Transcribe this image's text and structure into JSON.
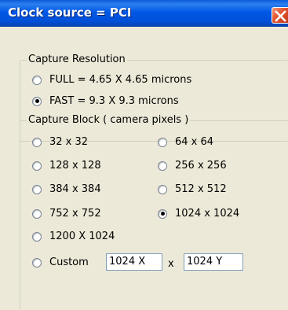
{
  "window": {
    "title": "Clock source = PCI",
    "close_icon": "close-x-icon"
  },
  "capture_resolution": {
    "legend": "Capture Resolution",
    "options": [
      {
        "label": "FULL = 4.65 X 4.65 microns",
        "selected": false
      },
      {
        "label": "FAST = 9.3 X 9.3 microns",
        "selected": true
      }
    ]
  },
  "capture_block": {
    "legend": "Capture Block ( camera pixels )",
    "options": [
      {
        "label": "32 x 32",
        "selected": false
      },
      {
        "label": "64 x 64",
        "selected": false
      },
      {
        "label": "128 x 128",
        "selected": false
      },
      {
        "label": "256 x 256",
        "selected": false
      },
      {
        "label": "384 x 384",
        "selected": false
      },
      {
        "label": "512 x 512",
        "selected": false
      },
      {
        "label": "752 x 752",
        "selected": false
      },
      {
        "label": "1024 x 1024",
        "selected": true
      },
      {
        "label": "1200 X 1024",
        "selected": false
      },
      {
        "label": "Custom",
        "selected": false
      }
    ],
    "custom_x_value": "1024 X",
    "custom_separator": "x",
    "custom_y_value": "1024 Y"
  }
}
